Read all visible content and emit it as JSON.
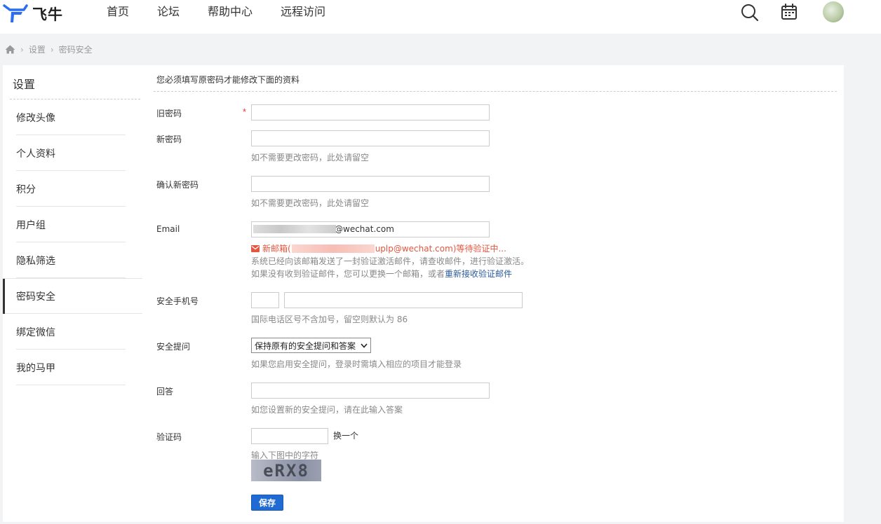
{
  "header": {
    "logo_text": "飞牛",
    "nav": [
      "首页",
      "论坛",
      "帮助中心",
      "远程访问"
    ]
  },
  "breadcrumb": [
    "设置",
    "密码安全"
  ],
  "sidebar": {
    "title": "设置",
    "items": [
      {
        "label": "修改头像"
      },
      {
        "label": "个人资料"
      },
      {
        "label": "积分"
      },
      {
        "label": "用户组"
      },
      {
        "label": "隐私筛选"
      },
      {
        "label": "密码安全"
      },
      {
        "label": "绑定微信"
      },
      {
        "label": "我的马甲"
      }
    ],
    "active_index": 5
  },
  "form": {
    "notice": "您必须填写原密码才能修改下面的资料",
    "old_password_label": "旧密码",
    "required_mark": "*",
    "new_password_label": "新密码",
    "new_password_hint": "如不需要更改密码，此处请留空",
    "confirm_password_label": "确认新密码",
    "confirm_password_hint": "如不需要更改密码，此处请留空",
    "email_label": "Email",
    "email_value_visible": "@wechat.com",
    "email_pending_prefix": "新邮箱(",
    "email_pending_suffix": "uplp@wechat.com)等待验证中...",
    "email_hint1": "系统已经向该邮箱发送了一封验证激活邮件，请查收邮件，进行验证激活。",
    "email_hint2_prefix": "如果没有收到验证邮件，您可以更换一个邮箱，或者",
    "email_hint2_link": "重新接收验证邮件",
    "phone_label": "安全手机号",
    "phone_hint": "国际电话区号不含加号，留空则默认为 86",
    "question_label": "安全提问",
    "question_selected": "保持原有的安全提问和答案",
    "question_hint": "如果您启用安全提问，登录时需填入相应的项目才能登录",
    "answer_label": "回答",
    "answer_hint": "如您设置新的安全提问，请在此输入答案",
    "captcha_label": "验证码",
    "captcha_refresh": "换一个",
    "captcha_hint": "输入下图中的字符",
    "captcha_text": "eRX8",
    "save_label": "保存"
  },
  "colors": {
    "accent": "#1f6bd3",
    "warning": "#e5553f",
    "link": "#2b5c9e",
    "logo_blue": "#2b6ef0"
  }
}
